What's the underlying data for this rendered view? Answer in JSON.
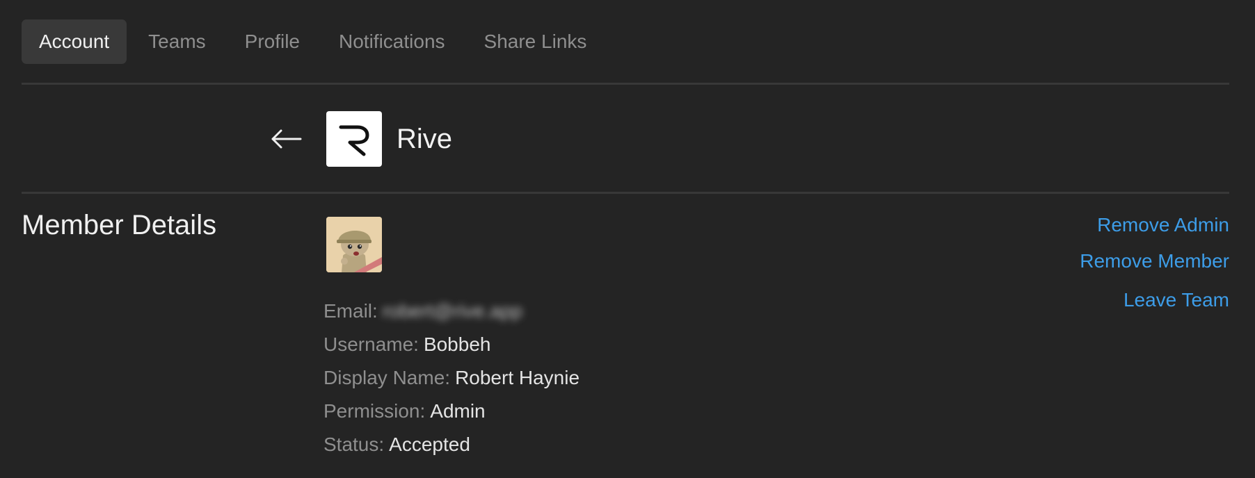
{
  "tabs": [
    {
      "label": "Account",
      "active": true
    },
    {
      "label": "Teams"
    },
    {
      "label": "Profile"
    },
    {
      "label": "Notifications"
    },
    {
      "label": "Share Links"
    }
  ],
  "team": {
    "name": "Rive",
    "logo_icon": "rive-logo-icon",
    "back_icon": "back-arrow-icon"
  },
  "member": {
    "section_title": "Member Details",
    "avatar_icon": "member-avatar-soldier",
    "email_label": "Email:",
    "email_value": "robert@rive.app",
    "username_label": "Username:",
    "username_value": "Bobbeh",
    "display_name_label": "Display Name:",
    "display_name_value": "Robert Haynie",
    "permission_label": "Permission:",
    "permission_value": "Admin",
    "status_label": "Status:",
    "status_value": "Accepted"
  },
  "actions": {
    "remove_admin": "Remove Admin",
    "remove_member": "Remove Member",
    "leave_team": "Leave Team"
  },
  "colors": {
    "background": "#242424",
    "active_tab": "#393939",
    "link": "#3d9de8",
    "muted_text": "#8f8f8f"
  }
}
